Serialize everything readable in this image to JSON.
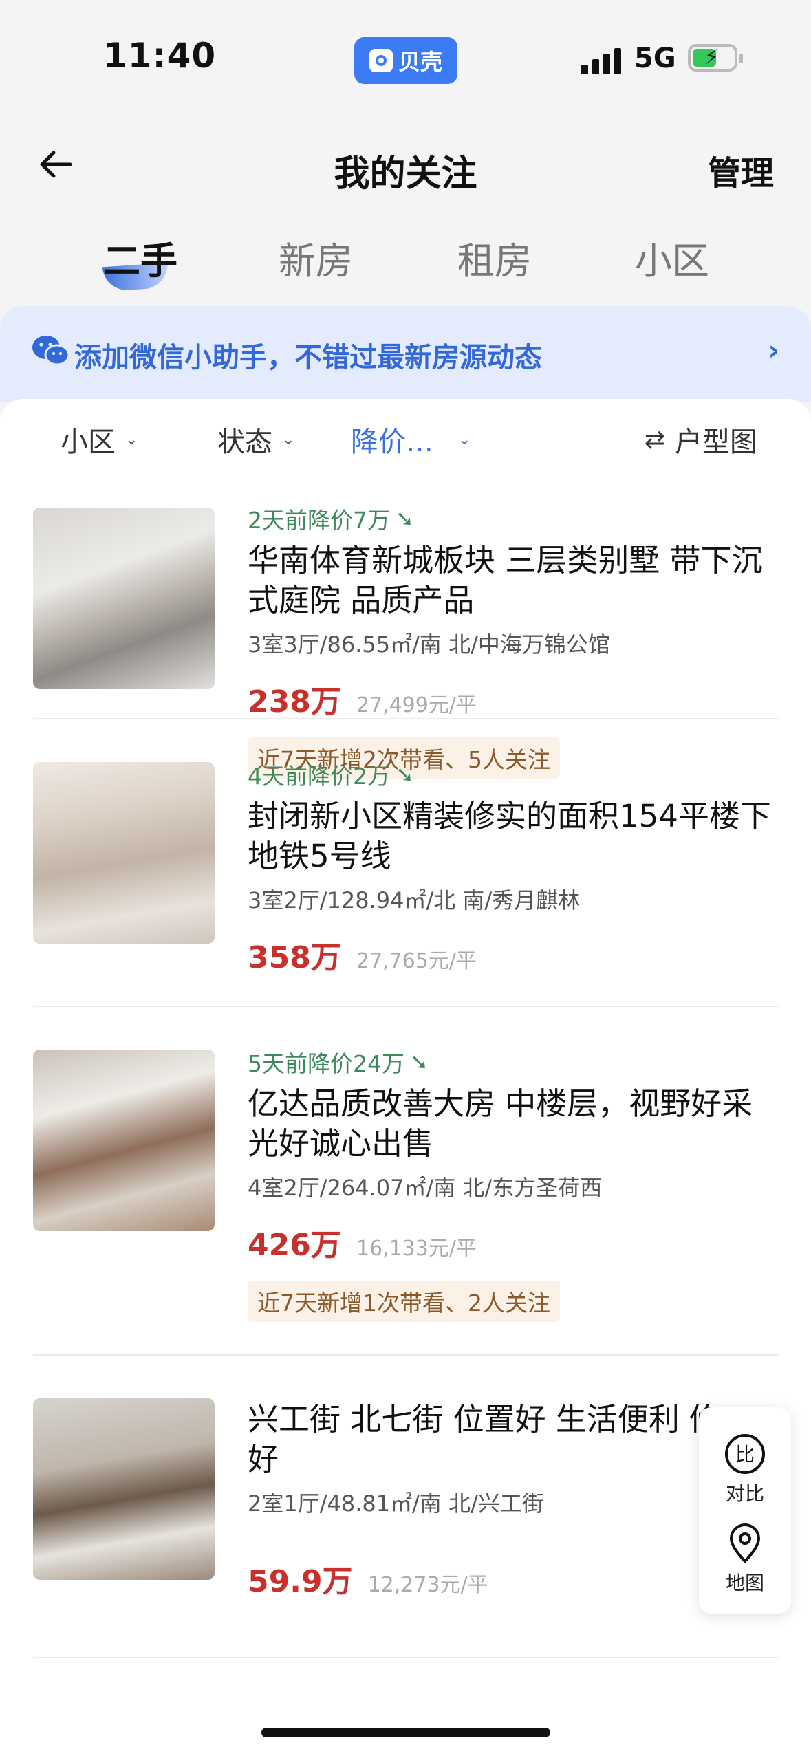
{
  "status_bar": {
    "time": "11:40",
    "app_name": "贝壳",
    "network": "5G"
  },
  "header": {
    "title": "我的关注",
    "manage": "管理"
  },
  "tabs": [
    {
      "label": "二手",
      "active": true
    },
    {
      "label": "新房",
      "active": false
    },
    {
      "label": "租房",
      "active": false
    },
    {
      "label": "小区",
      "active": false
    }
  ],
  "banner": {
    "text": "添加微信小助手，不错过最新房源动态",
    "icon": "wechat-icon"
  },
  "filters": {
    "community": "小区",
    "status": "状态",
    "price_drop": "降价…",
    "floorplan": "户型图"
  },
  "listings": [
    {
      "drop": "2天前降价7万",
      "title": "华南体育新城板块 三层类别墅 带下沉式庭院 品质产品",
      "attrs": "3室3厅/86.55㎡/南 北/中海万锦公馆",
      "price": "238万",
      "unit_price": "27,499元/平",
      "tag": "近7天新增2次带看、5人关注"
    },
    {
      "drop": "4天前降价2万",
      "title": "封闭新小区精装修实的面积154平楼下地铁5号线",
      "attrs": "3室2厅/128.94㎡/北 南/秀月麒林",
      "price": "358万",
      "unit_price": "27,765元/平"
    },
    {
      "drop": "5天前降价24万",
      "title": "亿达品质改善大房 中楼层，视野好采光好诚心出售",
      "attrs": "4室2厅/264.07㎡/南 北/东方圣荷西",
      "price": "426万",
      "unit_price": "16,133元/平",
      "tag": "近7天新增1次带看、2人关注"
    },
    {
      "title": "兴工街 北七街 位置好 生活便利 修好",
      "attrs": "2室1厅/48.81㎡/南 北/兴工街",
      "price": "59.9万",
      "unit_price": "12,273元/平"
    }
  ],
  "side_buttons": {
    "compare": "对比",
    "map": "地图"
  },
  "colors": {
    "accent": "#3a6fe0",
    "price": "#c8302c",
    "drop": "#3c8a5a"
  }
}
